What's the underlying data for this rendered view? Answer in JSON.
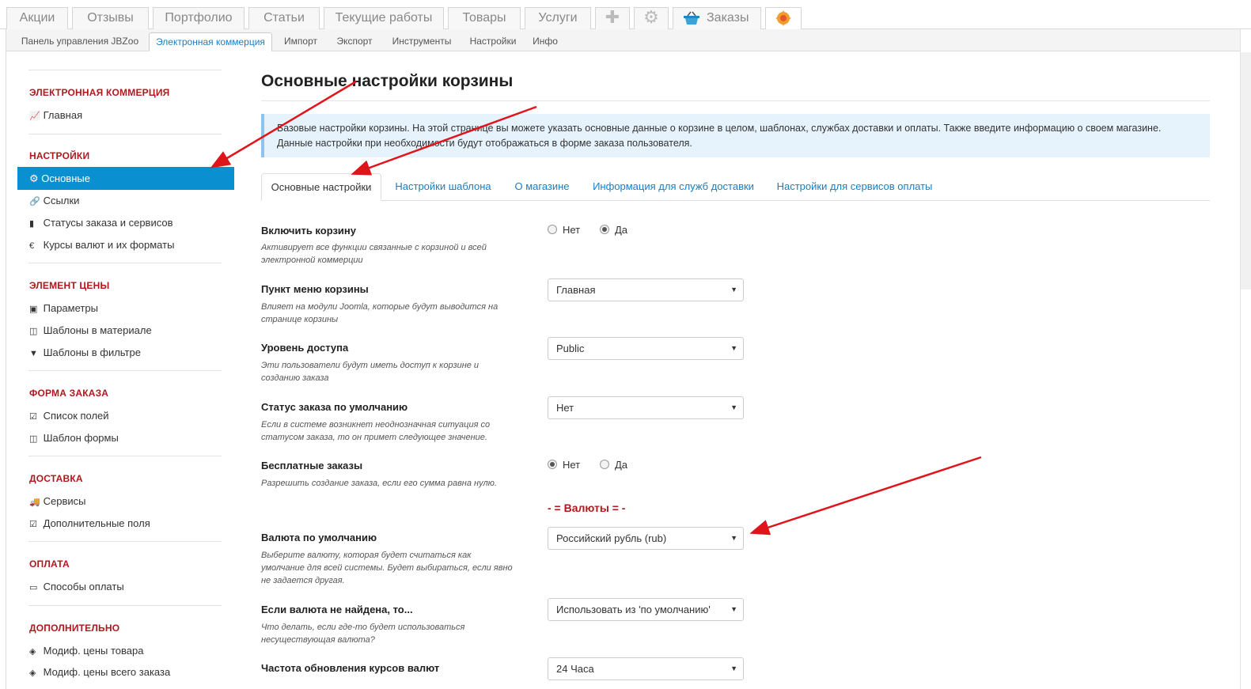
{
  "top_tabs": [
    {
      "label": "Акции"
    },
    {
      "label": "Отзывы"
    },
    {
      "label": "Портфолио"
    },
    {
      "label": "Статьи"
    },
    {
      "label": "Текущие работы"
    },
    {
      "label": "Товары"
    },
    {
      "label": "Услуги"
    },
    {
      "icon": "plus-icon"
    },
    {
      "icon": "gear-icon"
    },
    {
      "label": "Заказы",
      "icon": "basket-icon"
    },
    {
      "icon": "jbzoo-logo-icon"
    }
  ],
  "sub_tabs": [
    "Панель управления JBZoo",
    "Электронная коммерция",
    "Импорт",
    "Экспорт",
    "Инструменты",
    "Настройки",
    "Инфо"
  ],
  "sub_tabs_active": "Электронная коммерция",
  "sidebar": {
    "sections": [
      {
        "title": "ЭЛЕКТРОННАЯ КОММЕРЦИЯ",
        "items": [
          {
            "icon": "chart-icon",
            "label": "Главная"
          }
        ]
      },
      {
        "title": "НАСТРОЙКИ",
        "items": [
          {
            "icon": "gear-icon",
            "label": "Основные",
            "active": true
          },
          {
            "icon": "link-icon",
            "label": "Ссылки"
          },
          {
            "icon": "bookmark-icon",
            "label": "Статусы заказа и сервисов"
          },
          {
            "icon": "euro-icon",
            "label": "Курсы валют и их форматы"
          }
        ]
      },
      {
        "title": "ЭЛЕМЕНТ ЦЕНЫ",
        "items": [
          {
            "icon": "money-icon",
            "label": "Параметры"
          },
          {
            "icon": "columns-icon",
            "label": "Шаблоны в материале"
          },
          {
            "icon": "filter-icon",
            "label": "Шаблоны в фильтре"
          }
        ]
      },
      {
        "title": "ФОРМА ЗАКАЗА",
        "items": [
          {
            "icon": "checkbox-icon",
            "label": "Список полей"
          },
          {
            "icon": "columns-icon",
            "label": "Шаблон формы"
          }
        ]
      },
      {
        "title": "ДОСТАВКА",
        "items": [
          {
            "icon": "truck-icon",
            "label": "Сервисы"
          },
          {
            "icon": "checkbox-icon",
            "label": "Дополнительные поля"
          }
        ]
      },
      {
        "title": "ОПЛАТА",
        "items": [
          {
            "icon": "credit-card-icon",
            "label": "Способы оплаты"
          }
        ]
      },
      {
        "title": "ДОПОЛНИТЕЛЬНО",
        "items": [
          {
            "icon": "cubes-icon",
            "label": "Модиф. цены товара"
          },
          {
            "icon": "cubes-icon",
            "label": "Модиф. цены всего заказа"
          }
        ]
      }
    ]
  },
  "main": {
    "title": "Основные настройки корзины",
    "info_line1": "Базовые настройки корзины. На этой странице вы можете указать основные данные о корзине в целом, шаблонах, службах доставки и оплаты. Также введите информацию о своем магазине.",
    "info_line2": "Данные настройки при необходимости будут отображаться в форме заказа пользователя.",
    "tabs": [
      "Основные настройки",
      "Настройки шаблона",
      "О магазине",
      "Информация для служб доставки",
      "Настройки для сервисов оплаты"
    ],
    "tabs_active": "Основные настройки",
    "fields": {
      "enable_cart": {
        "label": "Включить корзину",
        "desc1": "Активирует все функции связанные с корзиной и всей",
        "desc2": "электронной коммерции",
        "opt_no": "Нет",
        "opt_yes": "Да",
        "selected": "Да"
      },
      "menu_item": {
        "label": "Пункт меню корзины",
        "desc1": "Влияет на модули Joomla, которые будут выводится на",
        "desc2": "странице корзины",
        "value": "Главная"
      },
      "access": {
        "label": "Уровень доступа",
        "desc1": "Эти пользователи будут иметь доступ к корзине и",
        "desc2": "созданию заказа",
        "value": "Public"
      },
      "default_status": {
        "label": "Статус заказа по умолчанию",
        "desc1": "Если в системе возникнет неоднозначная ситуация со",
        "desc2": "статусом заказа, то он примет следующее значение.",
        "value": "Нет"
      },
      "free_orders": {
        "label": "Бесплатные заказы",
        "desc1": "Разрешить создание заказа, если его сумма равна нулю.",
        "opt_no": "Нет",
        "opt_yes": "Да",
        "selected": "Нет"
      },
      "currency_section": "- = Валюты = -",
      "default_currency": {
        "label": "Валюта по умолчанию",
        "desc1": "Выберите валюту, которая будет считаться как",
        "desc2": "умолчание для всей системы. Будет выбираться, если явно",
        "desc3": "не задается другая.",
        "value": "Российский рубль (rub)"
      },
      "currency_not_found": {
        "label": "Если валюта не найдена, то...",
        "desc1": "Что делать, если где-то будет использоваться",
        "desc2": "несуществующая валюта?",
        "value": "Использовать из 'по умолчанию'"
      },
      "rates_update": {
        "label": "Частота обновления курсов валют",
        "value": "24 Часа"
      }
    }
  },
  "colors": {
    "accent": "#0a8fd0",
    "section_red": "#b0181d",
    "link_blue": "#1a7ec2",
    "annotation_arrow": "#e0151b"
  }
}
